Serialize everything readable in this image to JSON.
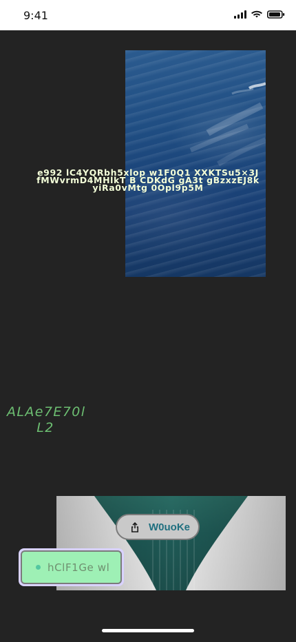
{
  "status_bar": {
    "time": "9:41",
    "icons": [
      "cellular-signal-icon",
      "wifi-icon",
      "battery-icon"
    ]
  },
  "overlay_text": "e992 lC4YQRbh5xlop w1F0Q1 XXKTSu5×3J fMWvrmD4MHlkT B CDKdG  gA3t gBzxzEJ8k yiRa0vMtg 0Opl9p5M",
  "green_text": "ALAe7E70l L2",
  "share_button": {
    "label": "W0uoKe",
    "icon": "share-icon"
  },
  "chip_button": {
    "label": "hClF1Ge wl",
    "dot": "status-dot"
  },
  "colors": {
    "background": "#232323",
    "overlay_text": "#f4ffd9",
    "green_text": "#6dbf72",
    "share_text": "#1f6f7f",
    "chip_fill": "#9ef0b5",
    "chip_outer": "#d9d2ff"
  }
}
